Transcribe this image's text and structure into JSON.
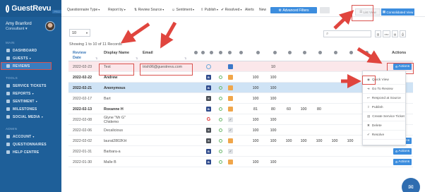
{
  "brand": {
    "name": "GuestRevu",
    "tag": "PRO"
  },
  "user": {
    "name": "Amy Branford",
    "role": "Consultant"
  },
  "sidebar": {
    "main_label": "MAIN",
    "main_items": [
      {
        "label": "DASHBOARD"
      },
      {
        "label": "GUESTS"
      },
      {
        "label": "REVIEWS"
      }
    ],
    "tools_label": "TOOLS",
    "tools_items": [
      {
        "label": "SERVICE TICKETS"
      },
      {
        "label": "REPORTS"
      },
      {
        "label": "SENTIMENT"
      },
      {
        "label": "MILESTONES"
      },
      {
        "label": "SOCIAL MEDIA"
      }
    ],
    "admin_label": "ADMIN",
    "admin_items": [
      {
        "label": "ACCOUNT"
      },
      {
        "label": "QUESTIONNAIRES"
      },
      {
        "label": "HELP CENTRE"
      }
    ]
  },
  "filters": [
    {
      "label": "Questionnaire Type"
    },
    {
      "label": "Report by"
    },
    {
      "label": "Review Source"
    },
    {
      "label": "Sentiment"
    },
    {
      "label": "Publish"
    },
    {
      "label": "Resolved"
    },
    {
      "label": "Alerts"
    },
    {
      "label": "New"
    }
  ],
  "buttons": {
    "advanced": "Advanced Filters",
    "list_view": "List View",
    "consolidated": "Consolidated View"
  },
  "toolbar": {
    "page_size": "10",
    "showing": "Showing 1 to 10 of 11 Records",
    "csv": "csv"
  },
  "table": {
    "headers": {
      "date": "Review Date",
      "name": "Display Name",
      "email": "Email",
      "actions": "Actions"
    },
    "rows": [
      {
        "date": "2022-02-23",
        "name": "Test",
        "email": "trish96@guestrevu.com",
        "src": "sky",
        "n1": "",
        "n2": "10",
        "n3": "",
        "n4": "",
        "n5": "",
        "n6": "",
        "n7": "",
        "action": "Actions",
        "style": "pink"
      },
      {
        "date": "2022-02-22",
        "name": "Andrew",
        "email": "",
        "src": "fb",
        "n1": "100",
        "n2": "100",
        "n3": "",
        "n4": "",
        "n5": "",
        "n6": "",
        "n7": "",
        "action": "",
        "style": "bold"
      },
      {
        "date": "2022-02-21",
        "name": "Anonymous",
        "email": "",
        "src": "fb",
        "n1": "100",
        "n2": "100",
        "n3": "",
        "n4": "",
        "n5": "",
        "n6": "",
        "n7": "",
        "action": "",
        "style": "blue"
      },
      {
        "date": "2022-02-17",
        "name": "Bart",
        "email": "",
        "src": "ms",
        "n1": "100",
        "n2": "100",
        "n3": "",
        "n4": "",
        "n5": "",
        "n6": "",
        "n7": "",
        "action": "",
        "style": ""
      },
      {
        "date": "2022-02-13",
        "name": "Roxanne H",
        "email": "",
        "src": "fb",
        "n1": "81",
        "n2": "80",
        "n3": "60",
        "n4": "100",
        "n5": "80",
        "n6": "",
        "n7": "",
        "action": "",
        "style": "bold"
      },
      {
        "date": "2022-02-08",
        "name": "Glyne \"Mr G\" Chidemo",
        "email": "",
        "src": "g",
        "n1": "100",
        "n2": "100",
        "n3": "",
        "n4": "",
        "n5": "",
        "n6": "",
        "n7": "",
        "action": "",
        "style": ""
      },
      {
        "date": "2022-02-06",
        "name": "Decalicious",
        "email": "",
        "src": "ms",
        "n1": "100",
        "n2": "100",
        "n3": "",
        "n4": "",
        "n5": "",
        "n6": "",
        "n7": "",
        "action": "",
        "style": ""
      },
      {
        "date": "2022-02-02",
        "name": "laurat2802KH",
        "email": "",
        "src": "ms",
        "n1": "100",
        "n2": "100",
        "n3": "100",
        "n4": "100",
        "n5": "100",
        "n6": "100",
        "n7": "100",
        "action": "Actions",
        "style": ""
      },
      {
        "date": "2022-01-31",
        "name": "Barbara-a",
        "email": "",
        "src": "fb",
        "n1": "",
        "n2": "",
        "n3": "",
        "n4": "",
        "n5": "",
        "n6": "",
        "n7": "",
        "action": "Actions",
        "style": ""
      },
      {
        "date": "2022-01-30",
        "name": "Malle B",
        "email": "",
        "src": "fb",
        "n1": "100",
        "n2": "100",
        "n3": "",
        "n4": "",
        "n5": "",
        "n6": "",
        "n7": "",
        "action": "Actions",
        "style": ""
      }
    ]
  },
  "menu": [
    {
      "label": "Quick View",
      "icon": "eye-icon"
    },
    {
      "label": "Go To Review",
      "icon": "arrow-right-icon"
    },
    {
      "label": "Respond at Source",
      "icon": "reply-icon"
    },
    {
      "label": "Publish",
      "icon": "upload-icon"
    },
    {
      "label": "Create Service Ticket",
      "icon": "ticket-icon"
    },
    {
      "label": "Delete",
      "icon": "trash-icon"
    },
    {
      "label": "Resolve",
      "icon": "check-icon"
    }
  ],
  "colors": {
    "accent": "#3c8dde",
    "sidebar": "#1e5f99",
    "annotation_red": "#d9534f",
    "selected_row": "#cfe3f5",
    "highlight_row": "#fbe7ea"
  }
}
